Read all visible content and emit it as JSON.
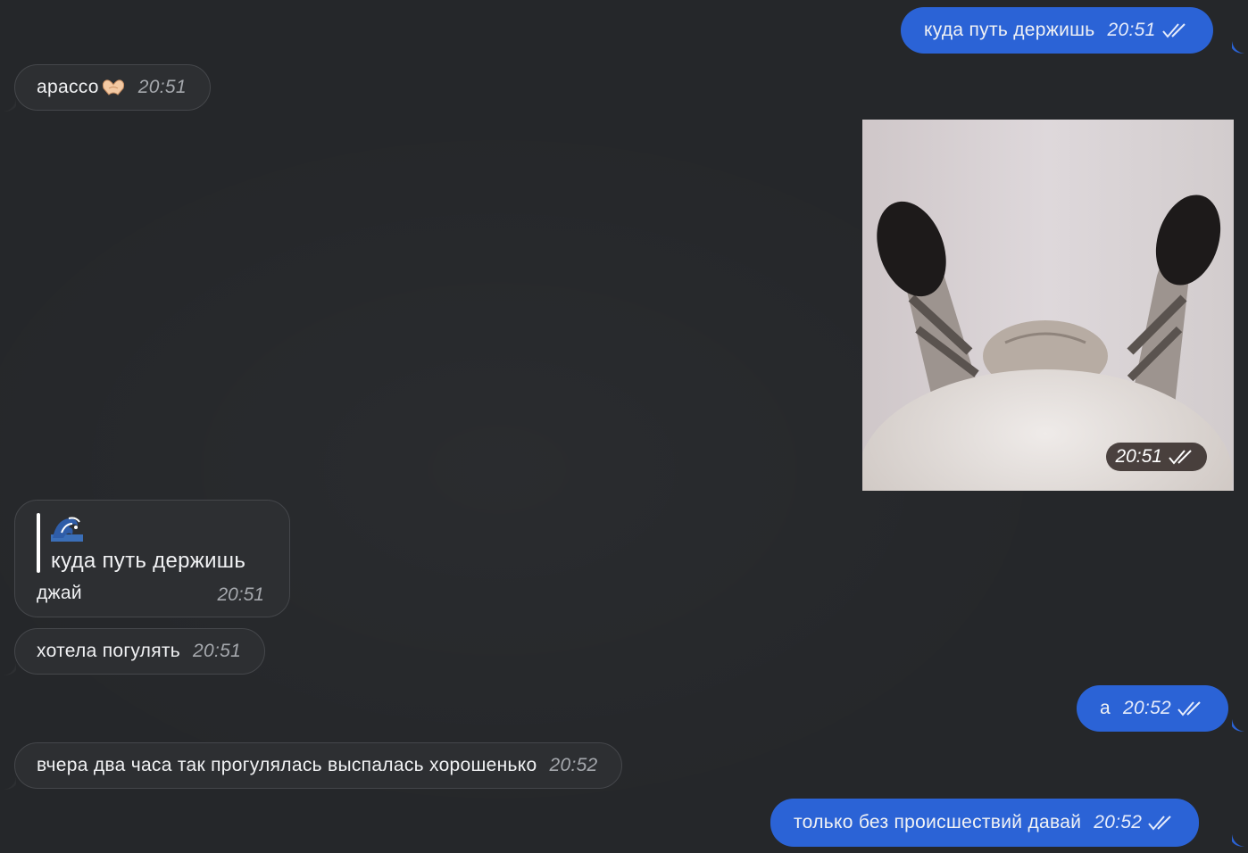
{
  "messages": {
    "m1": {
      "text": "куда путь держишь",
      "time": "20:51"
    },
    "m2": {
      "text": "арассо",
      "time": "20:51"
    },
    "photo": {
      "time": "20:51"
    },
    "reply": {
      "quote": "куда путь держишь",
      "text": "джай",
      "time": "20:51",
      "emoji_icon": "wave-icon"
    },
    "m4": {
      "text": "хотела погулять",
      "time": "20:51"
    },
    "m5": {
      "text": "а",
      "time": "20:52"
    },
    "m6": {
      "text": "вчера два часа так прогулялась выспалась хорошенько",
      "time": "20:52"
    },
    "m7": {
      "text": "только без происшествий давай",
      "time": "20:52"
    }
  },
  "colors": {
    "background": "#25272a",
    "incoming_bubble": "#2d2f32",
    "outgoing_bubble": "#2b63d6"
  },
  "icons": [
    "double-check-icon",
    "heart-hands-icon",
    "wave-icon"
  ]
}
